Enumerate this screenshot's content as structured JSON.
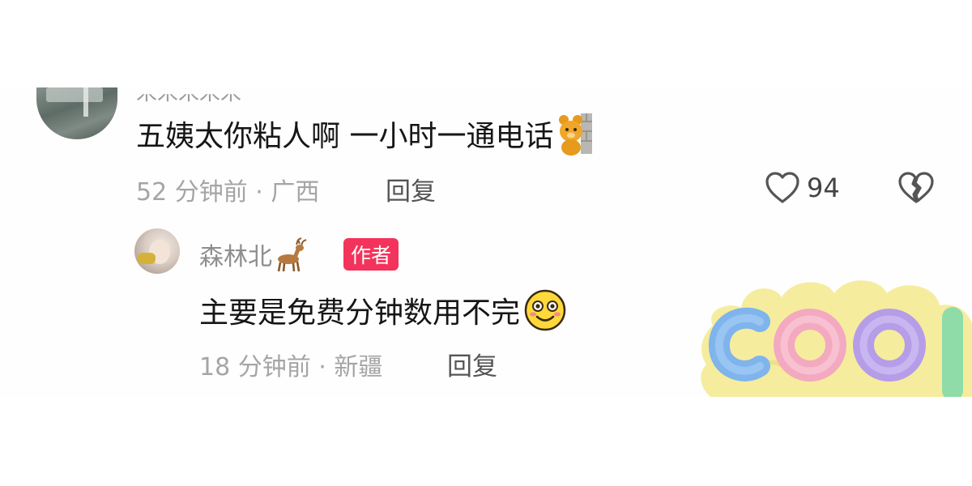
{
  "comment1": {
    "author_partial": "米米米米米",
    "text": "五姨太你粘人啊 一小时一通电话",
    "emoji": "bear-peeking-emoji",
    "meta": "52 分钟前 · 广西",
    "reply_label": "回复",
    "like_count": "94"
  },
  "comment2": {
    "author": "森林北",
    "author_emoji": "deer-emoji",
    "badge": "作者",
    "text": "主要是免费分钟数用不完",
    "emoji": "smiling-face-emoji",
    "meta": "18 分钟前 · 新疆",
    "reply_label": "回复"
  },
  "sticker": {
    "text": "COOL",
    "name": "cool-sticker"
  },
  "colors": {
    "badge": "#f3335b",
    "meta_text": "#a5a5a5",
    "body_text": "#161616"
  }
}
